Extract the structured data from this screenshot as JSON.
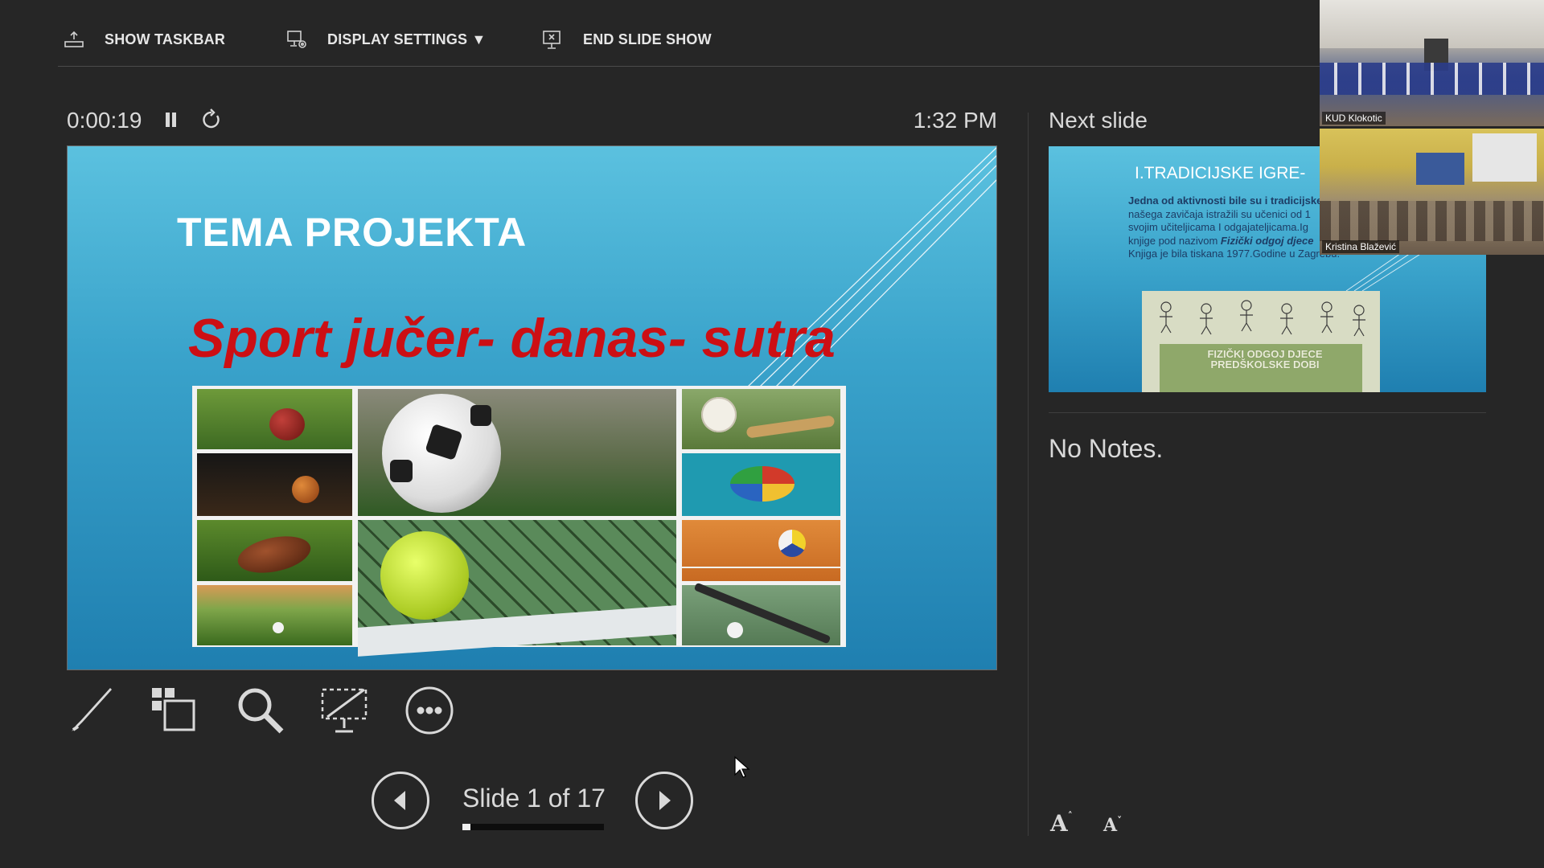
{
  "toolbar": {
    "show_taskbar": "SHOW TASKBAR",
    "display_settings": "DISPLAY SETTINGS ▼",
    "end_slide_show": "END SLIDE SHOW"
  },
  "timer": {
    "elapsed": "0:00:19",
    "clock": "1:32 PM"
  },
  "current_slide": {
    "title": "TEMA PROJEKTA",
    "subtitle": "Sport jučer- danas- sutra",
    "subtitle_color": "#cc0f14"
  },
  "navigation": {
    "counter": "Slide 1 of 17",
    "current": 1,
    "total": 17
  },
  "next_slide": {
    "label": "Next slide",
    "title": "I.TRADICIJSKE IGRE-",
    "lead": "Jedna od aktivnosti bile su i tradicijske",
    "line2": "našega zavičaja istražili su učenici od 1",
    "line3": "svojim učiteljicama I odgajateljicama.Ig",
    "line4_a": "knjige pod nazivom ",
    "line4_b": "Fizički odgoj djece",
    "line5": "Knjiga je bila tiskana 1977.Godine u Zagrebu.",
    "book_caption": "FIZIČKI ODGOJ DJECE PREDŠKOLSKE DOBI"
  },
  "notes": "No Notes.",
  "font_controls": {
    "increase": "A",
    "decrease": "A"
  },
  "participants": [
    {
      "name": "KUD Klokotic"
    },
    {
      "name": "Kristina Blažević"
    }
  ],
  "icons": [
    "taskbar-icon",
    "display-settings-icon",
    "end-show-icon",
    "pause-icon",
    "restart-icon",
    "pen-icon",
    "see-all-slides-icon",
    "zoom-icon",
    "black-screen-icon",
    "more-options-icon",
    "previous-icon",
    "next-icon",
    "increase-font-icon",
    "decrease-font-icon",
    "mouse-cursor-icon"
  ]
}
